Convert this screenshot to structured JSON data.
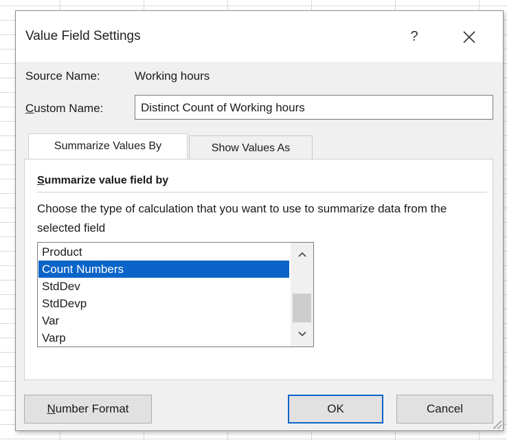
{
  "window": {
    "title": "Value Field Settings",
    "help_label": "?",
    "close_label": "✕"
  },
  "source": {
    "label": "Source Name:",
    "value": "Working hours"
  },
  "custom_name": {
    "label_first": "C",
    "label_rest": "ustom Name:",
    "value": "Distinct Count of Working hours"
  },
  "tabs": [
    {
      "label": "Summarize Values By",
      "active": true
    },
    {
      "label": "Show Values As",
      "active": false
    }
  ],
  "summarize": {
    "group_title_first": "S",
    "group_title_rest": "ummarize value field by",
    "description": "Choose the type of calculation that you want to use to summarize data from the selected field",
    "items": [
      {
        "label": "Product",
        "selected": false
      },
      {
        "label": "Count Numbers",
        "selected": true
      },
      {
        "label": "StdDev",
        "selected": false
      },
      {
        "label": "StdDevp",
        "selected": false
      },
      {
        "label": "Var",
        "selected": false
      },
      {
        "label": "Varp",
        "selected": false
      }
    ],
    "scroll_up_icon": "chevron-up-icon",
    "scroll_down_icon": "chevron-down-icon"
  },
  "buttons": {
    "number_format_first": "N",
    "number_format_rest": "umber Format",
    "ok": "OK",
    "cancel": "Cancel"
  },
  "colors": {
    "selection": "#0a64c8",
    "dialog_bg": "#f0f0f0"
  }
}
